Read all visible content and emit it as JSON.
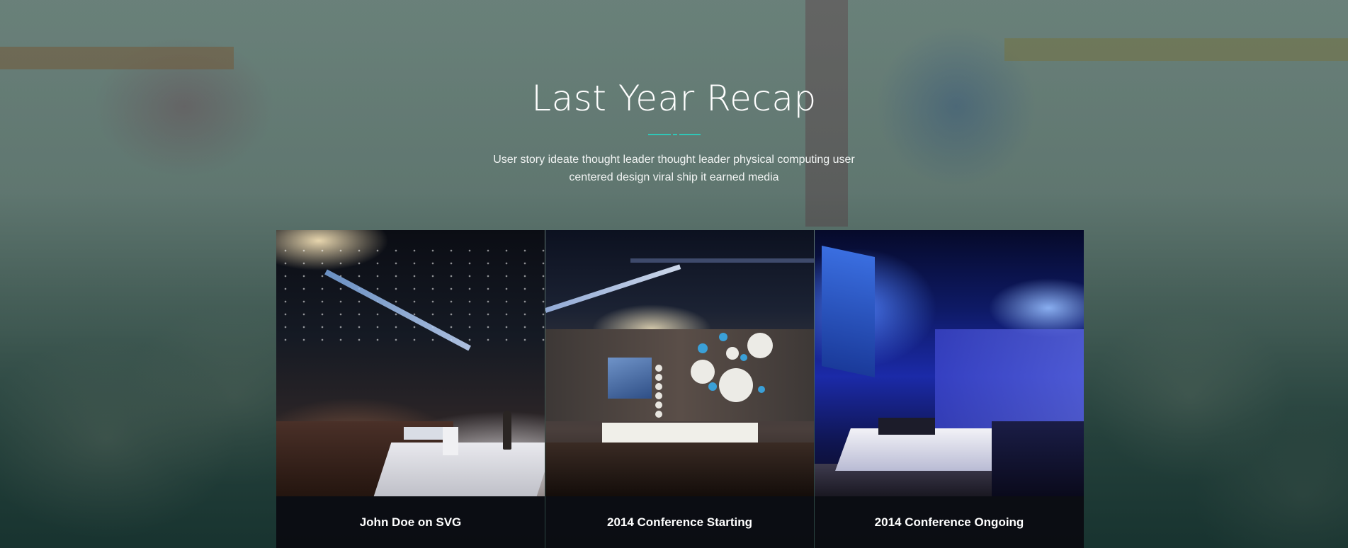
{
  "section": {
    "title": "Last Year Recap",
    "subtitle": "User story ideate thought leader thought leader physical computing user centered design viral ship it earned media",
    "accent_color": "#2fc7b7"
  },
  "gallery": {
    "items": [
      {
        "caption": "John Doe on SVG",
        "image": "conference-speaker-photo"
      },
      {
        "caption": "2014 Conference Starting",
        "image": "conference-panel-photo"
      },
      {
        "caption": "2014 Conference Ongoing",
        "image": "conference-blue-stage-photo"
      }
    ]
  }
}
